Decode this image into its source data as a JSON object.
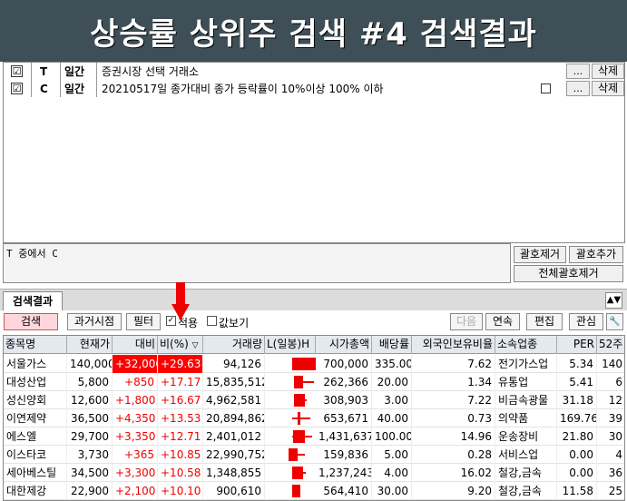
{
  "banner": {
    "title": "상승률 상위주 검색 #4 검색결과"
  },
  "conditions": [
    {
      "checked": "☑",
      "letter": "T",
      "kind": "일간",
      "desc": "증권시장 선택 거래소",
      "dots": "...",
      "delete": "삭제"
    },
    {
      "checked": "☑",
      "letter": "C",
      "kind": "일간",
      "desc": "20210517일 종가대비 종가 등락률이 10%이상 100% 이하",
      "dots": "...",
      "delete": "삭제"
    }
  ],
  "expression": {
    "text": "T 중에서 C"
  },
  "bracket_buttons": {
    "remove": "괄호제거",
    "add": "괄호추가",
    "remove_all": "전체괄호제거"
  },
  "tab": {
    "label": "검색결과",
    "scroll_icon": "▲▼"
  },
  "toolbar": {
    "search": "검색",
    "past": "과거시점",
    "filter": "필터",
    "apply_label": "적용",
    "value_view_label": "값보기",
    "next": "다음",
    "continuous": "연속",
    "edit": "편집",
    "watch": "관심",
    "wrench_icon": "🔧"
  },
  "table": {
    "headers": [
      "종목명",
      "현재가",
      "대비",
      "비(%)",
      "거래량",
      "L(일봉)H",
      "시가총액",
      "배당률",
      "외국인보유비율",
      "소속업종",
      "PER",
      "52주"
    ],
    "rows": [
      {
        "name": "서울가스",
        "price": "140,000",
        "change": "+32,000",
        "pct": "+29.63",
        "volume": "94,126",
        "mcap": "700,000",
        "div": "335.00",
        "foreign": "7.62",
        "sector": "전기가스업",
        "per": "5.34",
        "w52": "140",
        "hl": true
      },
      {
        "name": "대성산업",
        "price": "5,800",
        "change": "+850",
        "pct": "+17.17",
        "volume": "15,835,512",
        "mcap": "262,366",
        "div": "20.00",
        "foreign": "1.34",
        "sector": "유통업",
        "per": "5.41",
        "w52": "6",
        "hl": false
      },
      {
        "name": "성신양회",
        "price": "12,600",
        "change": "+1,800",
        "pct": "+16.67",
        "volume": "4,962,581",
        "mcap": "308,903",
        "div": "3.00",
        "foreign": "7.22",
        "sector": "비금속광물",
        "per": "31.18",
        "w52": "12",
        "hl": false
      },
      {
        "name": "이연제약",
        "price": "36,500",
        "change": "+4,350",
        "pct": "+13.53",
        "volume": "20,894,862",
        "mcap": "653,671",
        "div": "40.00",
        "foreign": "0.73",
        "sector": "의약품",
        "per": "169.76",
        "w52": "39",
        "hl": false
      },
      {
        "name": "에스엘",
        "price": "29,700",
        "change": "+3,350",
        "pct": "+12.71",
        "volume": "2,401,012",
        "mcap": "1,431,637",
        "div": "100.00",
        "foreign": "14.96",
        "sector": "운송장비",
        "per": "21.80",
        "w52": "30",
        "hl": false
      },
      {
        "name": "이스타코",
        "price": "3,730",
        "change": "+365",
        "pct": "+10.85",
        "volume": "22,990,752",
        "mcap": "159,836",
        "div": "5.00",
        "foreign": "0.28",
        "sector": "서비스업",
        "per": "0.00",
        "w52": "4",
        "hl": false
      },
      {
        "name": "세아베스틸",
        "price": "34,500",
        "change": "+3,300",
        "pct": "+10.58",
        "volume": "1,348,855",
        "mcap": "1,237,243",
        "div": "4.00",
        "foreign": "16.02",
        "sector": "철강,금속",
        "per": "0.00",
        "w52": "36",
        "hl": false
      },
      {
        "name": "대한제강",
        "price": "22,900",
        "change": "+2,100",
        "pct": "+10.10",
        "volume": "900,610",
        "mcap": "564,410",
        "div": "30.00",
        "foreign": "9.20",
        "sector": "철강,금속",
        "per": "11.58",
        "w52": "25",
        "hl": false
      }
    ]
  },
  "colors": {
    "banner": "#3e4f57",
    "up": "#e00000",
    "highlight": "#ff0000",
    "search_button": "#ffd6dc"
  }
}
